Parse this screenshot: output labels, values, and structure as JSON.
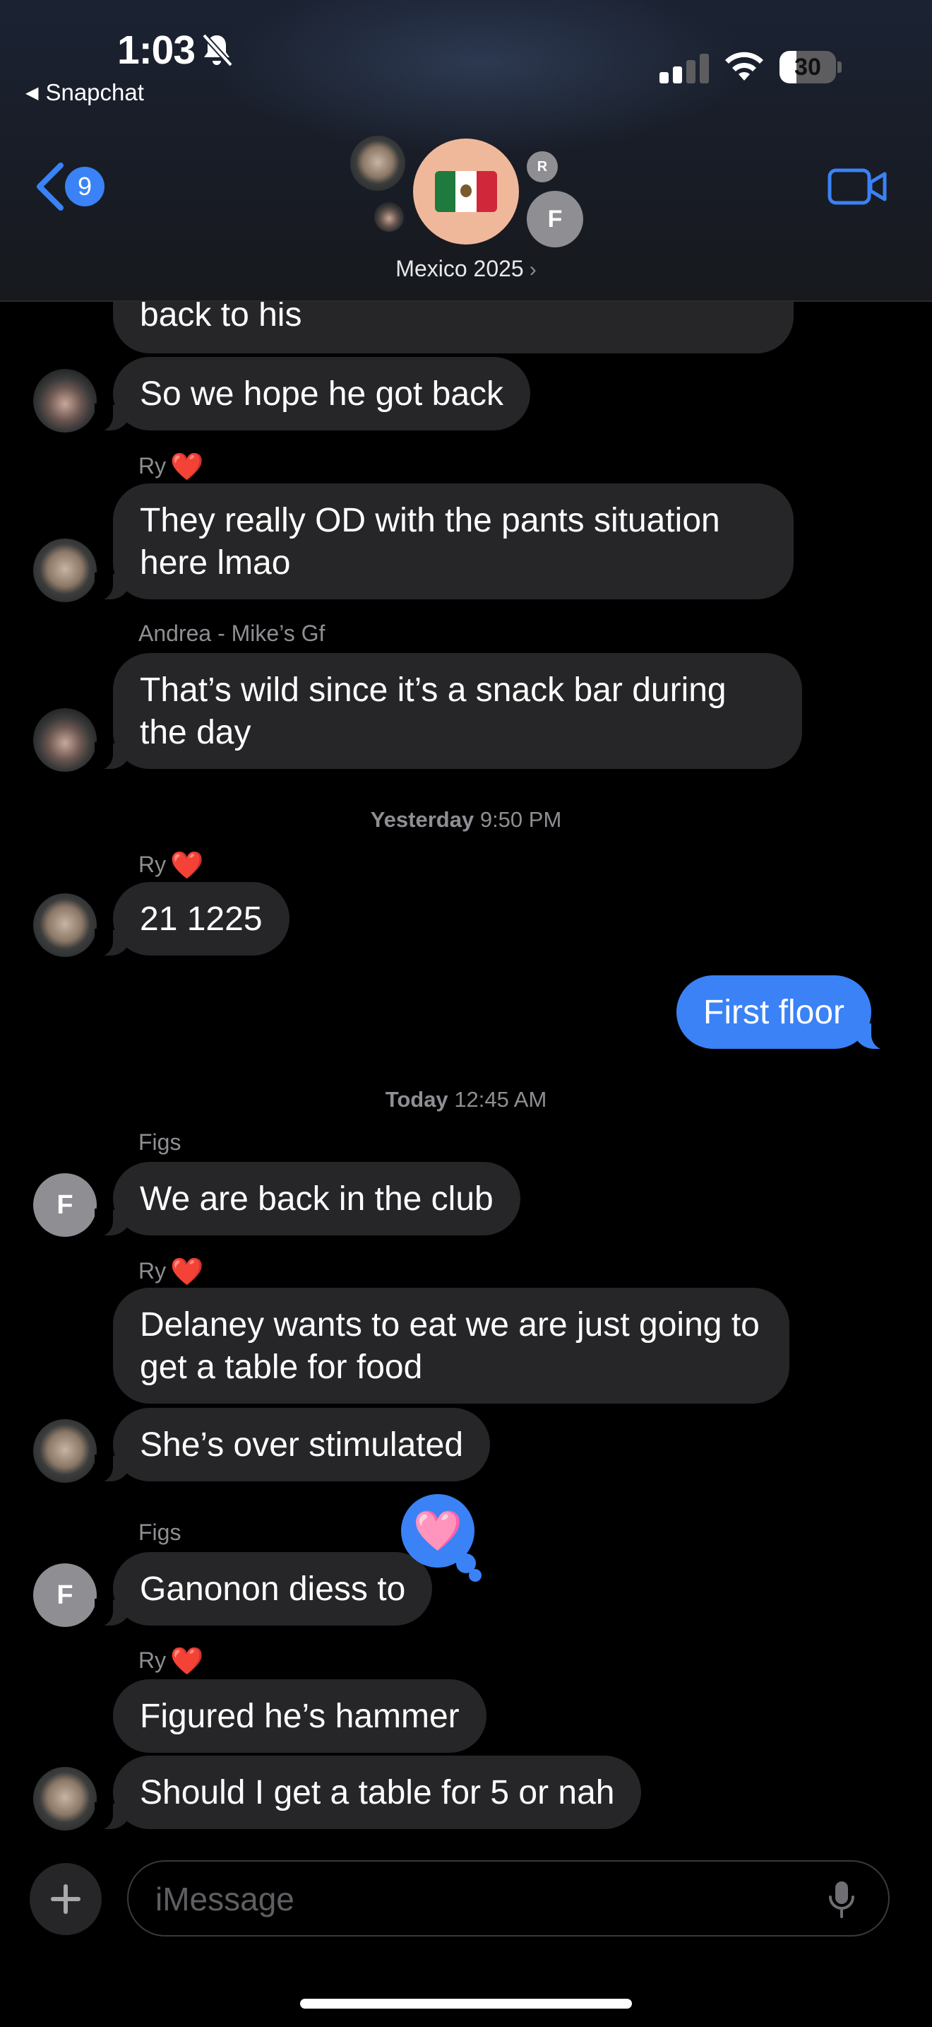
{
  "status_bar": {
    "time": "1:03",
    "back_app": "Snapchat",
    "battery": "30",
    "battery_level": 0.3
  },
  "nav": {
    "back_count": "9",
    "group_name": "Mexico 2025",
    "member_initials": [
      "R",
      "F"
    ]
  },
  "messages": [
    {
      "text": "back to his"
    },
    {
      "text": "So we hope he got back"
    },
    {
      "sender": "Ry",
      "text": "They really OD with the pants situation here lmao"
    },
    {
      "sender": "Andrea - Mike’s Gf",
      "text": "That’s wild since it’s a snack bar during the day"
    },
    {
      "timestamp_day": "Yesterday",
      "timestamp_time": "9:50 PM"
    },
    {
      "sender": "Ry",
      "text": "21 1225"
    },
    {
      "text": "First floor"
    },
    {
      "timestamp_day": "Today",
      "timestamp_time": "12:45 AM"
    },
    {
      "sender": "Figs",
      "initial": "F",
      "text": "We are back in the club"
    },
    {
      "sender": "Ry",
      "text": "Delaney wants to eat we are just going to get a table for food"
    },
    {
      "text": "She’s over stimulated"
    },
    {
      "sender": "Figs",
      "initial": "F",
      "text": "Ganonon diess to"
    },
    {
      "sender": "Ry",
      "text": "Figured he’s hammer"
    },
    {
      "text": "Should I get a table for 5 or nah"
    }
  ],
  "heart_emoji": "❤️",
  "reaction": "🩷",
  "composer": {
    "placeholder": "iMessage"
  },
  "colors": {
    "accent": "#3a82f6",
    "bubble_incoming": "#262628",
    "heart": "#e0312f"
  }
}
